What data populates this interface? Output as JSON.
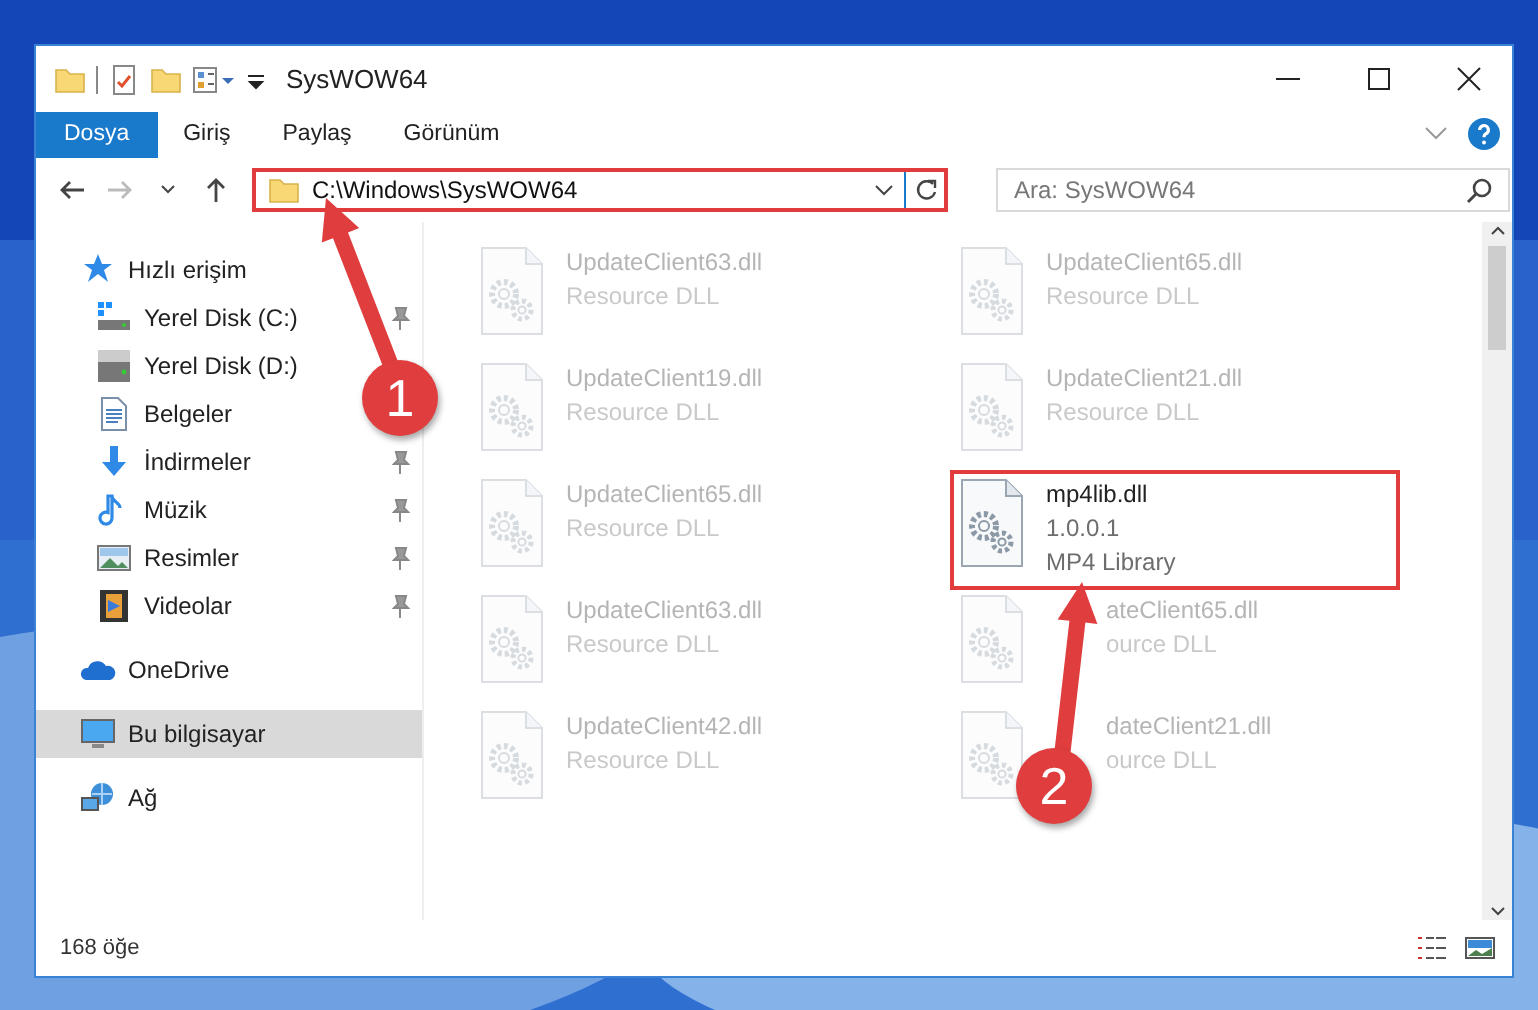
{
  "window": {
    "title": "SysWOW64"
  },
  "ribbon_tabs": [
    {
      "label": "Dosya",
      "kind": "file"
    },
    {
      "label": "Giriş",
      "kind": "tab"
    },
    {
      "label": "Paylaş",
      "kind": "tab"
    },
    {
      "label": "Görünüm",
      "kind": "tab"
    }
  ],
  "address_bar": {
    "path": "C:\\Windows\\SysWOW64",
    "highlighted": true
  },
  "search": {
    "placeholder": "Ara: SysWOW64"
  },
  "sidebar": {
    "items": [
      {
        "label": "Hızlı erişim",
        "kind": "star",
        "selected": false,
        "children": [
          {
            "label": "Yerel Disk (C:)",
            "kind": "drive-c",
            "pinned": true,
            "selected": false
          },
          {
            "label": "Yerel Disk (D:)",
            "kind": "drive",
            "pinned": false,
            "selected": false
          },
          {
            "label": "Belgeler",
            "kind": "document",
            "pinned": false,
            "selected": false
          },
          {
            "label": "İndirmeler",
            "kind": "download",
            "pinned": true,
            "selected": false
          },
          {
            "label": "Müzik",
            "kind": "music",
            "pinned": true,
            "selected": false
          },
          {
            "label": "Resimler",
            "kind": "pictures",
            "pinned": true,
            "selected": false
          },
          {
            "label": "Videolar",
            "kind": "video",
            "pinned": true,
            "selected": false
          }
        ]
      },
      {
        "label": "OneDrive",
        "kind": "cloud",
        "selected": false
      },
      {
        "label": "Bu bilgisayar",
        "kind": "computer",
        "selected": true
      },
      {
        "label": "Ağ",
        "kind": "network",
        "selected": false
      }
    ]
  },
  "files": [
    {
      "name": "UpdateClient63.dll",
      "type": "Resource DLL",
      "dimmed": true,
      "highlighted": false
    },
    {
      "name": "UpdateClient65.dll",
      "type": "Resource DLL",
      "dimmed": true,
      "highlighted": false
    },
    {
      "name": "UpdateClient19.dll",
      "type": "Resource DLL",
      "dimmed": true,
      "highlighted": false
    },
    {
      "name": "UpdateClient21.dll",
      "type": "Resource DLL",
      "dimmed": true,
      "highlighted": false
    },
    {
      "name": "UpdateClient65.dll",
      "type": "Resource DLL",
      "dimmed": true,
      "highlighted": false
    },
    {
      "name": "mp4lib.dll",
      "version": "1.0.0.1",
      "type": "MP4 Library",
      "dimmed": false,
      "highlighted": true
    },
    {
      "name": "UpdateClient63.dll",
      "type": "Resource DLL",
      "dimmed": true,
      "highlighted": false
    },
    {
      "name": "ateClient65.dll",
      "type": "ource DLL",
      "kind": "partly-covered",
      "dimmed": true,
      "highlighted": false
    },
    {
      "name": "UpdateClient42.dll",
      "type": "Resource DLL",
      "dimmed": true,
      "highlighted": false
    },
    {
      "name": "dateClient21.dll",
      "type": "ource DLL",
      "kind": "partly-covered",
      "dimmed": true,
      "highlighted": false
    }
  ],
  "status_bar": {
    "item_count": "168 öğe"
  },
  "annotations": [
    {
      "number": "1"
    },
    {
      "number": "2"
    }
  ]
}
